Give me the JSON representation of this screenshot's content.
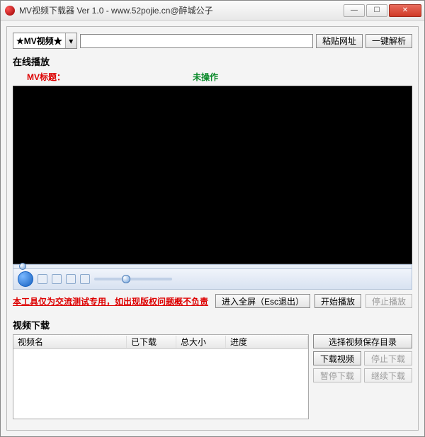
{
  "window": {
    "title": "MV视频下载器 Ver 1.0 - www.52pojie.cn@醉城公子"
  },
  "toolbar": {
    "source_label": "★MV视频★",
    "url_value": "",
    "paste_btn": "粘贴网址",
    "parse_btn": "一键解析"
  },
  "play": {
    "section_label": "在线播放",
    "title_label": "MV标题：",
    "status_text": "未操作",
    "disclaimer": "本工具仅为交流测试专用，如出现版权问题概不负责",
    "fullscreen_btn": "进入全屏（Esc退出）",
    "start_btn": "开始播放",
    "stop_btn": "停止播放"
  },
  "download": {
    "section_label": "视频下载",
    "cols": {
      "name": "视频名",
      "downloaded": "已下载",
      "total": "总大小",
      "progress": "进度"
    },
    "choose_dir_btn": "选择视频保存目录",
    "download_btn": "下载视频",
    "stop_btn": "停止下载",
    "pause_btn": "暂停下载",
    "resume_btn": "继续下载"
  }
}
